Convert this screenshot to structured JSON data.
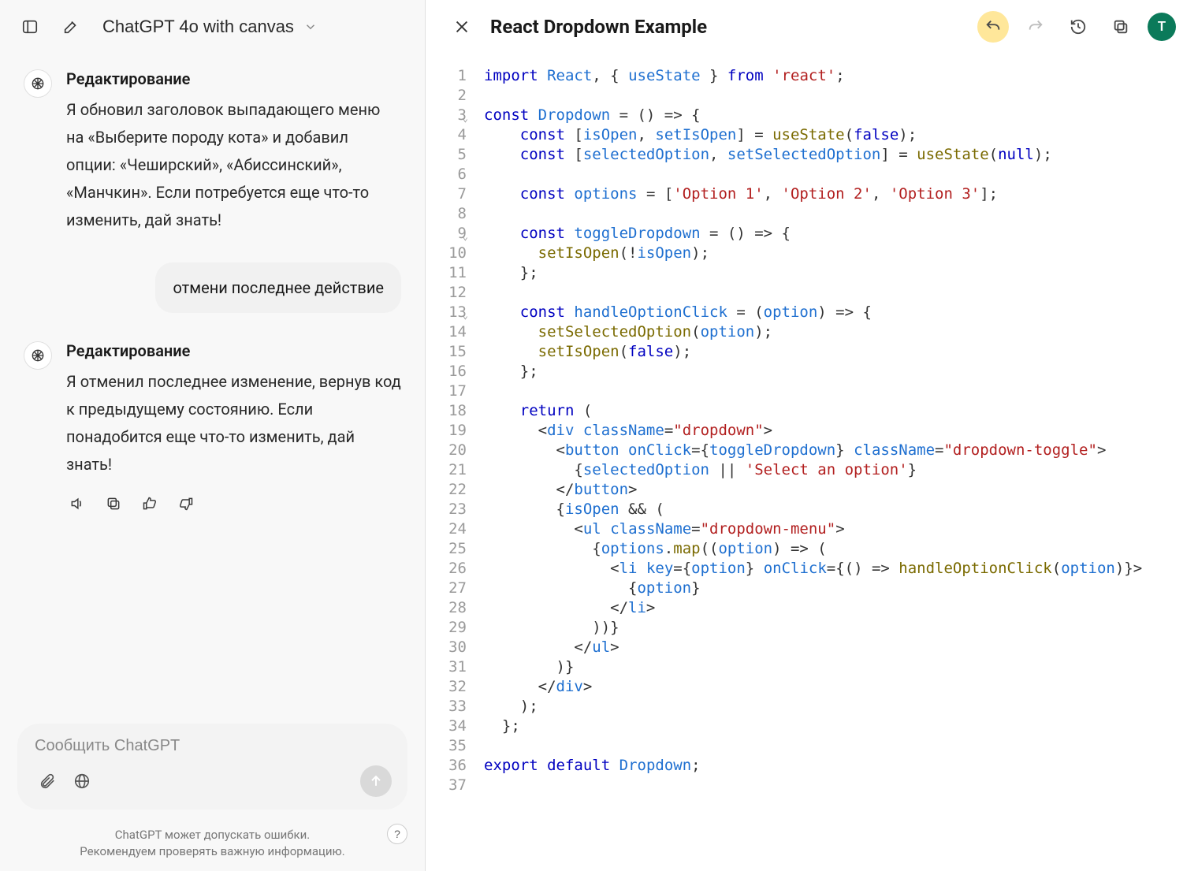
{
  "header": {
    "model_label": "ChatGPT 4o with canvas"
  },
  "chat": {
    "m1_title": "Редактирование",
    "m1_body": "Я обновил заголовок выпадающего меню на «Выберите породу кота» и добавил опции: «Чеширский», «Абиссинский», «Манчкин». Если потребуется еще что-то изменить, дай знать!",
    "user1": "отмени последнее действие",
    "m2_title": "Редактирование",
    "m2_body": "Я отменил последнее изменение, вернув код к предыдущему состоянию. Если понадобится еще что-то изменить, дай знать!"
  },
  "composer": {
    "placeholder": "Сообщить ChatGPT"
  },
  "footer": {
    "line1": "ChatGPT может допускать ошибки.",
    "line2": "Рекомендуем проверять важную информацию."
  },
  "canvas": {
    "title": "React Dropdown Example",
    "user_initial": "T",
    "lines": [
      {
        "n": 1,
        "fold": false,
        "segs": [
          [
            "kw",
            "import"
          ],
          [
            "pn",
            " "
          ],
          [
            "id",
            "React"
          ],
          [
            "pn",
            ", { "
          ],
          [
            "id",
            "useState"
          ],
          [
            "pn",
            " } "
          ],
          [
            "kw",
            "from"
          ],
          [
            "pn",
            " "
          ],
          [
            "str",
            "'react'"
          ],
          [
            "pn",
            ";"
          ]
        ]
      },
      {
        "n": 2,
        "fold": false,
        "segs": []
      },
      {
        "n": 3,
        "fold": true,
        "segs": [
          [
            "kw",
            "const"
          ],
          [
            "pn",
            " "
          ],
          [
            "id",
            "Dropdown"
          ],
          [
            "pn",
            " = () => {"
          ]
        ]
      },
      {
        "n": 4,
        "fold": false,
        "segs": [
          [
            "pn",
            "    "
          ],
          [
            "kw",
            "const"
          ],
          [
            "pn",
            " ["
          ],
          [
            "id",
            "isOpen"
          ],
          [
            "pn",
            ", "
          ],
          [
            "id",
            "setIsOpen"
          ],
          [
            "pn",
            "] = "
          ],
          [
            "fn",
            "useState"
          ],
          [
            "pn",
            "("
          ],
          [
            "kw",
            "false"
          ],
          [
            "pn",
            ");"
          ]
        ]
      },
      {
        "n": 5,
        "fold": false,
        "segs": [
          [
            "pn",
            "    "
          ],
          [
            "kw",
            "const"
          ],
          [
            "pn",
            " ["
          ],
          [
            "id",
            "selectedOption"
          ],
          [
            "pn",
            ", "
          ],
          [
            "id",
            "setSelectedOption"
          ],
          [
            "pn",
            "] = "
          ],
          [
            "fn",
            "useState"
          ],
          [
            "pn",
            "("
          ],
          [
            "kw",
            "null"
          ],
          [
            "pn",
            ");"
          ]
        ]
      },
      {
        "n": 6,
        "fold": false,
        "segs": []
      },
      {
        "n": 7,
        "fold": false,
        "segs": [
          [
            "pn",
            "    "
          ],
          [
            "kw",
            "const"
          ],
          [
            "pn",
            " "
          ],
          [
            "id",
            "options"
          ],
          [
            "pn",
            " = ["
          ],
          [
            "str",
            "'Option 1'"
          ],
          [
            "pn",
            ", "
          ],
          [
            "str",
            "'Option 2'"
          ],
          [
            "pn",
            ", "
          ],
          [
            "str",
            "'Option 3'"
          ],
          [
            "pn",
            "];"
          ]
        ]
      },
      {
        "n": 8,
        "fold": false,
        "segs": []
      },
      {
        "n": 9,
        "fold": true,
        "segs": [
          [
            "pn",
            "    "
          ],
          [
            "kw",
            "const"
          ],
          [
            "pn",
            " "
          ],
          [
            "id",
            "toggleDropdown"
          ],
          [
            "pn",
            " = () => {"
          ]
        ]
      },
      {
        "n": 10,
        "fold": false,
        "segs": [
          [
            "pn",
            "      "
          ],
          [
            "fn",
            "setIsOpen"
          ],
          [
            "pn",
            "(!"
          ],
          [
            "id",
            "isOpen"
          ],
          [
            "pn",
            ");"
          ]
        ]
      },
      {
        "n": 11,
        "fold": false,
        "segs": [
          [
            "pn",
            "    };"
          ]
        ]
      },
      {
        "n": 12,
        "fold": false,
        "segs": []
      },
      {
        "n": 13,
        "fold": true,
        "segs": [
          [
            "pn",
            "    "
          ],
          [
            "kw",
            "const"
          ],
          [
            "pn",
            " "
          ],
          [
            "id",
            "handleOptionClick"
          ],
          [
            "pn",
            " = ("
          ],
          [
            "id",
            "option"
          ],
          [
            "pn",
            ") => {"
          ]
        ]
      },
      {
        "n": 14,
        "fold": false,
        "segs": [
          [
            "pn",
            "      "
          ],
          [
            "fn",
            "setSelectedOption"
          ],
          [
            "pn",
            "("
          ],
          [
            "id",
            "option"
          ],
          [
            "pn",
            ");"
          ]
        ]
      },
      {
        "n": 15,
        "fold": false,
        "segs": [
          [
            "pn",
            "      "
          ],
          [
            "fn",
            "setIsOpen"
          ],
          [
            "pn",
            "("
          ],
          [
            "kw",
            "false"
          ],
          [
            "pn",
            ");"
          ]
        ]
      },
      {
        "n": 16,
        "fold": false,
        "segs": [
          [
            "pn",
            "    };"
          ]
        ]
      },
      {
        "n": 17,
        "fold": false,
        "segs": []
      },
      {
        "n": 18,
        "fold": false,
        "segs": [
          [
            "pn",
            "    "
          ],
          [
            "kw",
            "return"
          ],
          [
            "pn",
            " ("
          ]
        ]
      },
      {
        "n": 19,
        "fold": false,
        "segs": [
          [
            "pn",
            "      <"
          ],
          [
            "tg",
            "div"
          ],
          [
            "pn",
            " "
          ],
          [
            "id",
            "className"
          ],
          [
            "pn",
            "="
          ],
          [
            "str",
            "\"dropdown\""
          ],
          [
            "pn",
            ">"
          ]
        ]
      },
      {
        "n": 20,
        "fold": false,
        "segs": [
          [
            "pn",
            "        <"
          ],
          [
            "tg",
            "button"
          ],
          [
            "pn",
            " "
          ],
          [
            "id",
            "onClick"
          ],
          [
            "pn",
            "={"
          ],
          [
            "id",
            "toggleDropdown"
          ],
          [
            "pn",
            "} "
          ],
          [
            "id",
            "className"
          ],
          [
            "pn",
            "="
          ],
          [
            "str",
            "\"dropdown-toggle\""
          ],
          [
            "pn",
            ">"
          ]
        ]
      },
      {
        "n": 21,
        "fold": false,
        "segs": [
          [
            "pn",
            "          {"
          ],
          [
            "id",
            "selectedOption"
          ],
          [
            "pn",
            " || "
          ],
          [
            "str",
            "'Select an option'"
          ],
          [
            "pn",
            "}"
          ]
        ]
      },
      {
        "n": 22,
        "fold": false,
        "segs": [
          [
            "pn",
            "        </"
          ],
          [
            "tg",
            "button"
          ],
          [
            "pn",
            ">"
          ]
        ]
      },
      {
        "n": 23,
        "fold": false,
        "segs": [
          [
            "pn",
            "        {"
          ],
          [
            "id",
            "isOpen"
          ],
          [
            "pn",
            " && ("
          ]
        ]
      },
      {
        "n": 24,
        "fold": false,
        "segs": [
          [
            "pn",
            "          <"
          ],
          [
            "tg",
            "ul"
          ],
          [
            "pn",
            " "
          ],
          [
            "id",
            "className"
          ],
          [
            "pn",
            "="
          ],
          [
            "str",
            "\"dropdown-menu\""
          ],
          [
            "pn",
            ">"
          ]
        ]
      },
      {
        "n": 25,
        "fold": false,
        "segs": [
          [
            "pn",
            "            {"
          ],
          [
            "id",
            "options"
          ],
          [
            "pn",
            "."
          ],
          [
            "fn",
            "map"
          ],
          [
            "pn",
            "(("
          ],
          [
            "id",
            "option"
          ],
          [
            "pn",
            ") => ("
          ]
        ]
      },
      {
        "n": 26,
        "fold": false,
        "segs": [
          [
            "pn",
            "              <"
          ],
          [
            "tg",
            "li"
          ],
          [
            "pn",
            " "
          ],
          [
            "id",
            "key"
          ],
          [
            "pn",
            "={"
          ],
          [
            "id",
            "option"
          ],
          [
            "pn",
            "} "
          ],
          [
            "id",
            "onClick"
          ],
          [
            "pn",
            "={() => "
          ],
          [
            "fn",
            "handleOptionClick"
          ],
          [
            "pn",
            "("
          ],
          [
            "id",
            "option"
          ],
          [
            "pn",
            ")}>"
          ]
        ]
      },
      {
        "n": 27,
        "fold": false,
        "segs": [
          [
            "pn",
            "                {"
          ],
          [
            "id",
            "option"
          ],
          [
            "pn",
            "}"
          ]
        ]
      },
      {
        "n": 28,
        "fold": false,
        "segs": [
          [
            "pn",
            "              </"
          ],
          [
            "tg",
            "li"
          ],
          [
            "pn",
            ">"
          ]
        ]
      },
      {
        "n": 29,
        "fold": false,
        "segs": [
          [
            "pn",
            "            ))}"
          ]
        ]
      },
      {
        "n": 30,
        "fold": false,
        "segs": [
          [
            "pn",
            "          </"
          ],
          [
            "tg",
            "ul"
          ],
          [
            "pn",
            ">"
          ]
        ]
      },
      {
        "n": 31,
        "fold": false,
        "segs": [
          [
            "pn",
            "        )}"
          ]
        ]
      },
      {
        "n": 32,
        "fold": false,
        "segs": [
          [
            "pn",
            "      </"
          ],
          [
            "tg",
            "div"
          ],
          [
            "pn",
            ">"
          ]
        ]
      },
      {
        "n": 33,
        "fold": false,
        "segs": [
          [
            "pn",
            "    );"
          ]
        ]
      },
      {
        "n": 34,
        "fold": false,
        "segs": [
          [
            "pn",
            "  };"
          ]
        ]
      },
      {
        "n": 35,
        "fold": false,
        "segs": []
      },
      {
        "n": 36,
        "fold": false,
        "segs": [
          [
            "kw",
            "export"
          ],
          [
            "pn",
            " "
          ],
          [
            "kw",
            "default"
          ],
          [
            "pn",
            " "
          ],
          [
            "id",
            "Dropdown"
          ],
          [
            "pn",
            ";"
          ]
        ]
      },
      {
        "n": 37,
        "fold": false,
        "segs": []
      }
    ]
  }
}
